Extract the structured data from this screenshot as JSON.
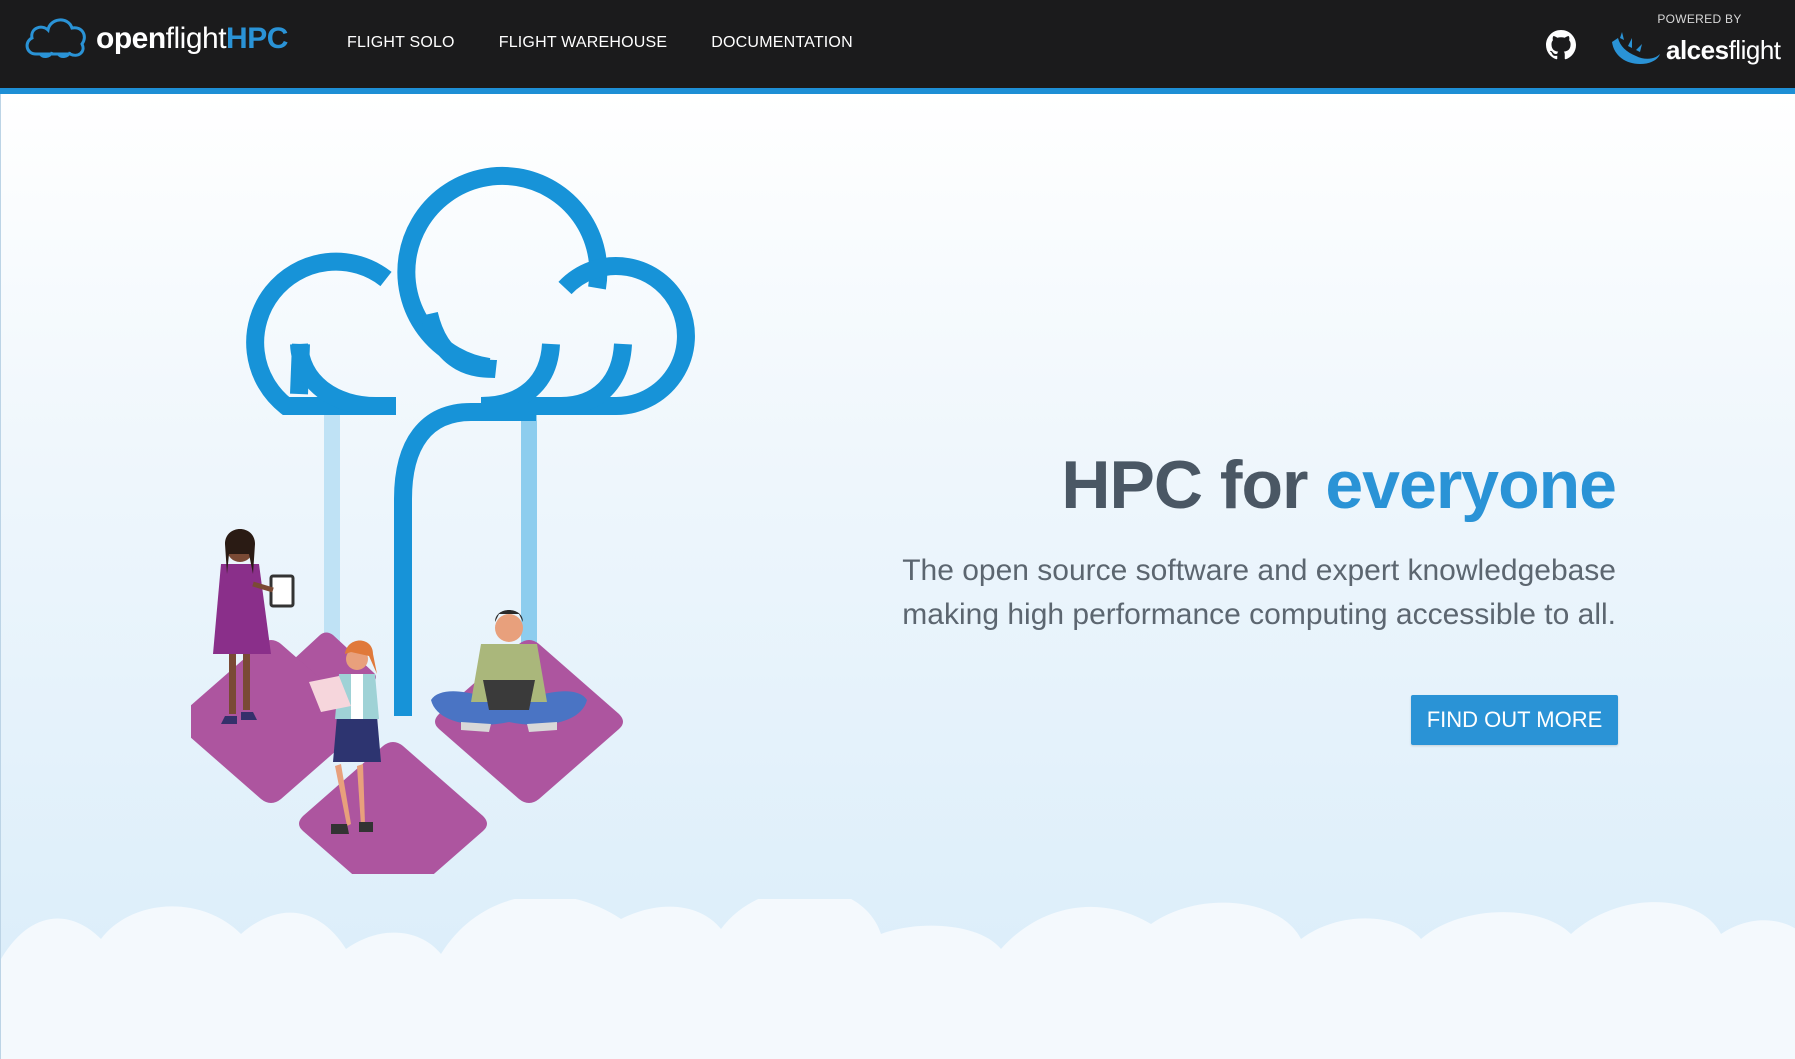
{
  "brand": {
    "logo_open": "open",
    "logo_flight": "flight",
    "logo_hpc": "HPC"
  },
  "nav": {
    "items": [
      {
        "label": "FLIGHT SOLO"
      },
      {
        "label": "FLIGHT WAREHOUSE"
      },
      {
        "label": "DOCUMENTATION"
      }
    ]
  },
  "header_right": {
    "github_icon": "github-icon",
    "powered_by": "POWERED BY",
    "partner_bold": "alces",
    "partner_light": "flight"
  },
  "hero": {
    "title_main": "HPC for ",
    "title_accent": "everyone",
    "subtitle_line1": "The open source software and expert knowledgebase",
    "subtitle_line2": "making high performance computing accessible to all.",
    "cta_label": "FIND OUT MORE"
  },
  "colors": {
    "navbar": "#1b1b1c",
    "accent": "#2a93d6",
    "heading": "#4a5764",
    "platform": "#ad559f"
  }
}
